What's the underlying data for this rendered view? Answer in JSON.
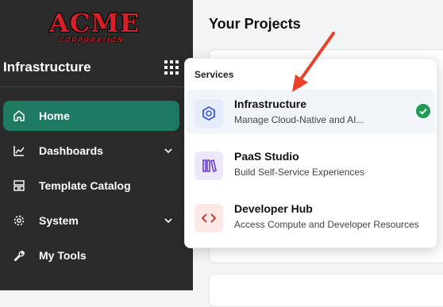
{
  "logo": {
    "main": "ACME",
    "sub": "CORPORATION"
  },
  "sidebar": {
    "title": "Infrastructure",
    "items": [
      {
        "label": "Home",
        "icon": "home-icon",
        "active": true
      },
      {
        "label": "Dashboards",
        "icon": "chart-icon",
        "expandable": true
      },
      {
        "label": "Template Catalog",
        "icon": "template-icon"
      },
      {
        "label": "System",
        "icon": "gear-icon",
        "expandable": true
      },
      {
        "label": "My Tools",
        "icon": "wrench-icon"
      }
    ]
  },
  "main": {
    "title": "Your Projects"
  },
  "services_menu": {
    "header": "Services",
    "items": [
      {
        "name": "Infrastructure",
        "description": "Manage Cloud-Native and AI...",
        "icon": "hexagon-icon",
        "color": "#3b5bdb",
        "bg": "#e7ecfb",
        "selected": true
      },
      {
        "name": "PaaS Studio",
        "description": "Build Self-Service Experiences",
        "icon": "books-icon",
        "color": "#6d3fc9",
        "bg": "#ede7fb"
      },
      {
        "name": "Developer Hub",
        "description": "Access Compute and Developer Resources",
        "icon": "code-icon",
        "color": "#c92a2a",
        "bg": "#fde8e8"
      }
    ]
  },
  "colors": {
    "sidebar_bg": "#2b2b2b",
    "active_item": "#1f7a63",
    "check": "#1f9d55",
    "arrow": "#e8412c"
  }
}
